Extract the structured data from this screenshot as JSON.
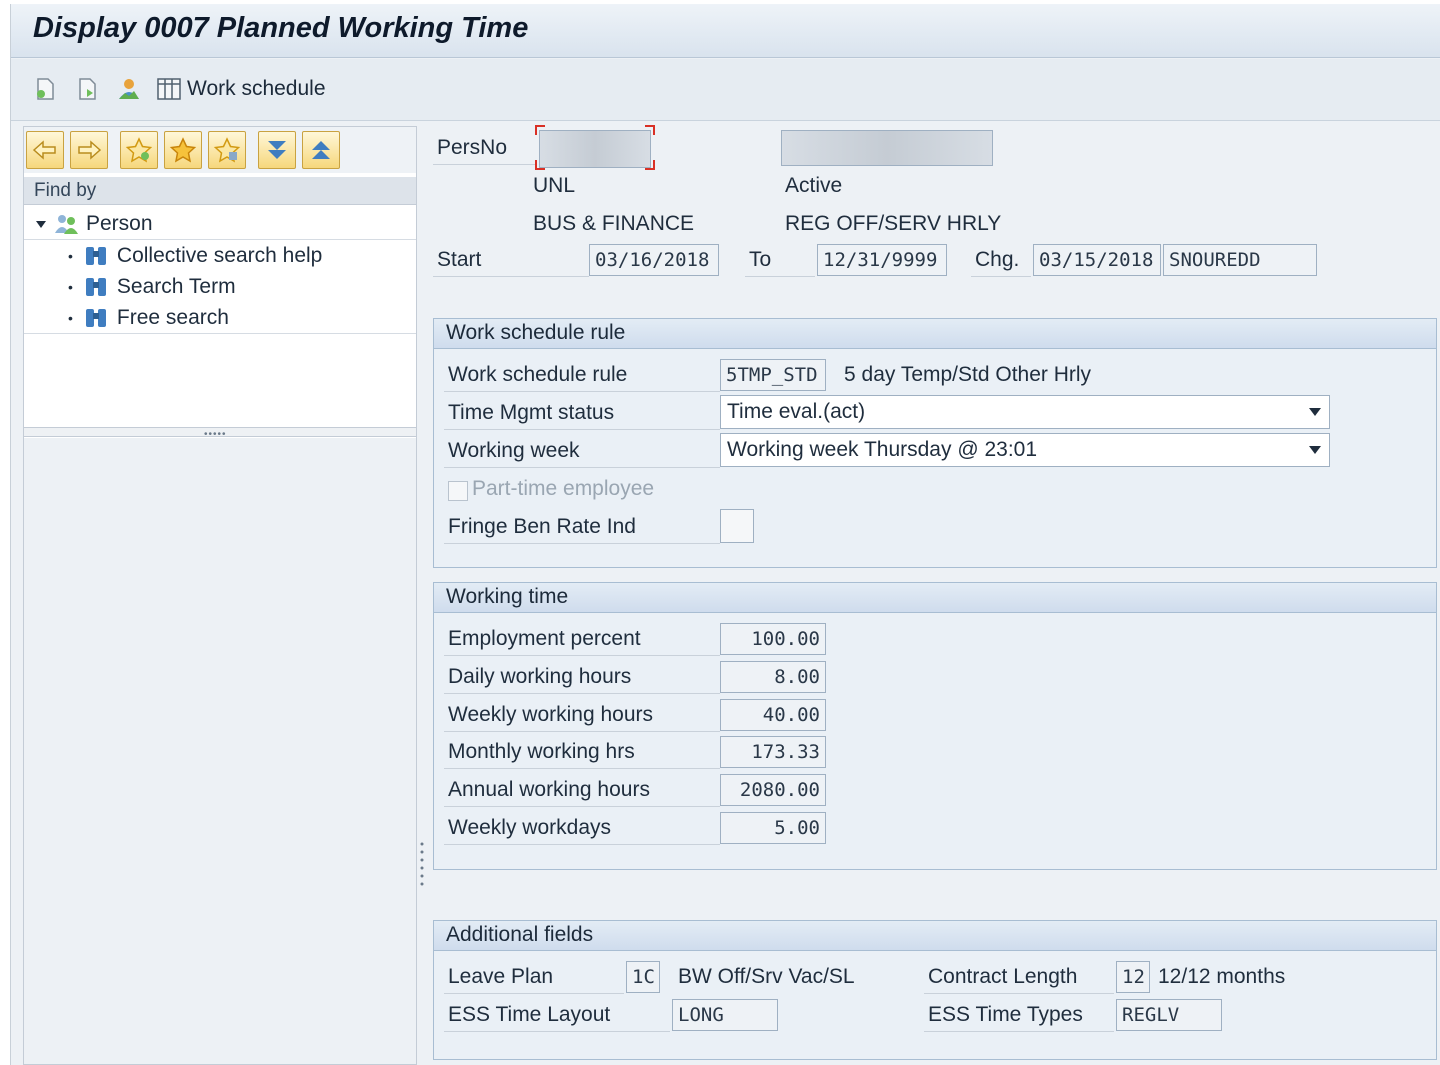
{
  "window": {
    "title": "Display 0007 Planned Working Time"
  },
  "toolbar": {
    "work_schedule_label": "Work schedule",
    "icons": [
      "new-entry-icon",
      "copy-icon",
      "person-overview-icon",
      "work-schedule-icon"
    ]
  },
  "navigator": {
    "find_by_label": "Find by",
    "nav_icons": [
      "back-arrow-icon",
      "forward-arrow-icon",
      "favorite-add-icon",
      "favorite-star-icon",
      "favorite-edit-icon",
      "expand-down-icon",
      "collapse-up-icon"
    ],
    "root": {
      "label": "Person"
    },
    "items": [
      {
        "label": "Collective search help"
      },
      {
        "label": "Search Term"
      },
      {
        "label": "Free search"
      }
    ]
  },
  "header": {
    "persno_label": "PersNo",
    "persno_value": "",
    "name_value": "",
    "line1_left": "UNL",
    "line1_right": "Active",
    "line2_left": "BUS & FINANCE",
    "line2_right": "REG OFF/SERV HRLY",
    "start_label": "Start",
    "start_value": "03/16/2018",
    "to_label": "To",
    "to_value": "12/31/9999",
    "chg_label": "Chg.",
    "chg_date": "03/15/2018",
    "chg_user": "SNOUREDD"
  },
  "work_schedule_rule": {
    "title": "Work schedule rule",
    "rule_label": "Work schedule rule",
    "rule_code": "5TMP_STD",
    "rule_text": "5 day Temp/Std Other Hrly",
    "time_mgmt_label": "Time Mgmt status",
    "time_mgmt_value": "Time eval.(act)",
    "working_week_label": "Working week",
    "working_week_value": "Working week Thursday @ 23:01",
    "part_time_label": "Part-time employee",
    "fringe_label": "Fringe Ben Rate Ind",
    "fringe_value": ""
  },
  "working_time": {
    "title": "Working time",
    "rows": [
      {
        "label": "Employment percent",
        "value": "100.00"
      },
      {
        "label": "Daily working hours",
        "value": "8.00"
      },
      {
        "label": "Weekly working hours",
        "value": "40.00"
      },
      {
        "label": "Monthly working hrs",
        "value": "173.33"
      },
      {
        "label": "Annual working hours",
        "value": "2080.00"
      },
      {
        "label": "Weekly workdays",
        "value": "5.00"
      }
    ]
  },
  "additional_fields": {
    "title": "Additional fields",
    "leave_plan_label": "Leave Plan",
    "leave_plan_code": "1C",
    "leave_plan_text": "BW Off/Srv Vac/SL",
    "contract_length_label": "Contract Length",
    "contract_length_code": "12",
    "contract_length_text": "12/12 months",
    "ess_layout_label": "ESS Time Layout",
    "ess_layout_value": "LONG",
    "ess_types_label": "ESS Time Types",
    "ess_types_value": "REGLV"
  },
  "colors": {
    "title_bg": "#d9e3ee",
    "group_head": "#cfdced",
    "nav_button": "#f6d77c",
    "required_marker": "#d93025"
  }
}
